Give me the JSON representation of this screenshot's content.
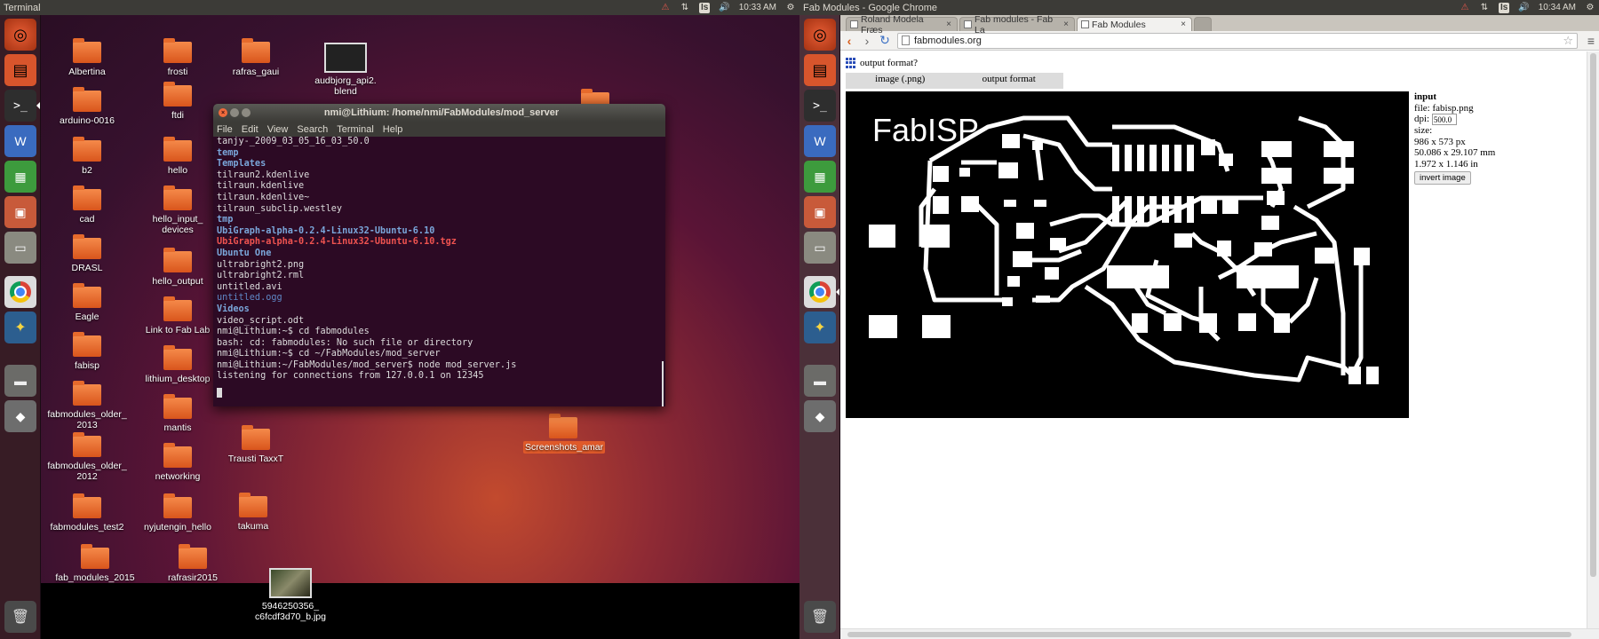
{
  "left": {
    "panel_title": "Terminal",
    "clock": "10:33 AM",
    "kb_layout": "Is",
    "desktop_icons": [
      "Albertina",
      "frosti",
      "rafras_gaui",
      "audbjorg_api2.\nblend",
      "arduino-0016",
      "ftdi",
      "b2",
      "hello",
      "cad",
      "hello_input_\ndevices",
      "DRASL",
      "hello_output",
      "Eagle",
      "Link to Fab Lab",
      "fabisp",
      "lithium_desktop",
      "fabmodules_older_\n2013",
      "mantis",
      "fabmodules_older_\n2012",
      "networking",
      "Trausti TaxxT",
      "fabmodules_test2",
      "nyjutengin_hello",
      "takuma",
      "fab_modules_2015",
      "rafrasir2015",
      "5946250356_\nc6fcdf3d70_b.jpg",
      "Screenshots_amar"
    ],
    "terminal": {
      "title": "nmi@Lithium: /home/nmi/FabModules/mod_server",
      "menu": [
        "File",
        "Edit",
        "View",
        "Search",
        "Terminal",
        "Help"
      ],
      "lines": [
        {
          "t": "tanjy-_2009_03_05_16_03_50.0",
          "c": ""
        },
        {
          "t": "temp",
          "c": "dir"
        },
        {
          "t": "Templates",
          "c": "dir"
        },
        {
          "t": "tilraun2.kdenlive",
          "c": ""
        },
        {
          "t": "tilraun.kdenlive",
          "c": ""
        },
        {
          "t": "tilraun.kdenlive~",
          "c": ""
        },
        {
          "t": "tilraun_subclip.westley",
          "c": ""
        },
        {
          "t": "tmp",
          "c": "dir"
        },
        {
          "t": "UbiGraph-alpha-0.2.4-Linux32-Ubuntu-6.10",
          "c": "dir"
        },
        {
          "t": "UbiGraph-alpha-0.2.4-Linux32-Ubuntu-6.10.tgz",
          "c": "arc"
        },
        {
          "t": "Ubuntu One",
          "c": "dir"
        },
        {
          "t": "ultrabright2.png",
          "c": ""
        },
        {
          "t": "ultrabright2.rml",
          "c": ""
        },
        {
          "t": "untitled.avi",
          "c": ""
        },
        {
          "t": "untitled.ogg",
          "c": "med"
        },
        {
          "t": "Videos",
          "c": "dir"
        },
        {
          "t": "video_script.odt",
          "c": ""
        },
        {
          "t": "nmi@Lithium:~$ cd fabmodules",
          "c": ""
        },
        {
          "t": "bash: cd: fabmodules: No such file or directory",
          "c": ""
        },
        {
          "t": "nmi@Lithium:~$ cd ~/FabModules/mod_server",
          "c": ""
        },
        {
          "t": "nmi@Lithium:~/FabModules/mod_server$ node mod_server.js",
          "c": ""
        },
        {
          "t": "listening for connections from 127.0.0.1 on 12345",
          "c": ""
        }
      ]
    }
  },
  "right": {
    "panel_title": "Fab Modules - Google Chrome",
    "clock": "10:34 AM",
    "kb_layout": "Is",
    "tabs": [
      {
        "label": "Roland Modela Fræs"
      },
      {
        "label": "Fab modules - Fab La"
      },
      {
        "label": "Fab Modules"
      }
    ],
    "url": "fabmodules.org",
    "output_format_label": "output format?",
    "format_cells": [
      "image (.png)",
      "output format"
    ],
    "pcb_text": "FabISP",
    "input": {
      "heading": "input",
      "file": "file: fabisp.png",
      "dpi_label": "dpi:",
      "dpi_value": "500.0",
      "size_label": "size:",
      "size_px": "986 x 573 px",
      "size_mm": "50.086 x 29.107 mm",
      "size_in": "1.972 x 1.146 in",
      "invert_label": "invert image"
    }
  },
  "colors": {
    "ubuntu_orange": "#dd4814",
    "panel_bg": "#3c3b37",
    "terminal_bg": "#2c0a24"
  }
}
